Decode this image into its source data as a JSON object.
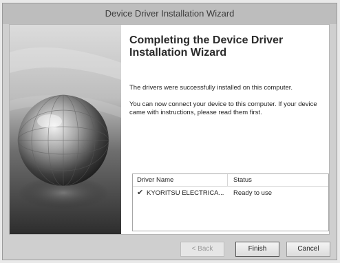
{
  "window": {
    "title": "Device Driver Installation Wizard"
  },
  "page": {
    "heading": "Completing the Device Driver Installation Wizard",
    "message_success": "The drivers were successfully installed on this computer.",
    "message_instructions": "You can now connect your device to this computer. If your device came with instructions, please read them first."
  },
  "driver_list": {
    "columns": [
      "Driver Name",
      "Status"
    ],
    "rows": [
      {
        "icon": "check-icon",
        "name": "KYORITSU ELECTRICA...",
        "status": "Ready to use"
      }
    ]
  },
  "buttons": {
    "back": "< Back",
    "finish": "Finish",
    "cancel": "Cancel"
  }
}
